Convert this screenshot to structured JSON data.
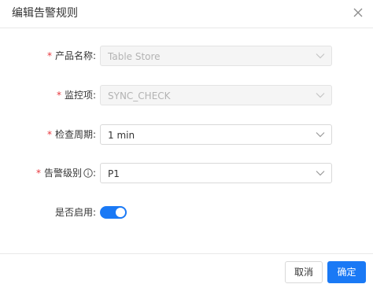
{
  "dialog": {
    "title": "编辑告警规则",
    "close_icon": "close-icon"
  },
  "form": {
    "product": {
      "required_mark": "*",
      "label": "产品名称:",
      "value": "Table Store",
      "disabled": true
    },
    "monitor_item": {
      "required_mark": "*",
      "label": "监控项:",
      "value": "SYNC_CHECK",
      "disabled": true
    },
    "check_period": {
      "required_mark": "*",
      "label": "检查周期:",
      "value": "1 min"
    },
    "alert_level": {
      "required_mark": "*",
      "label": "告警级别",
      "label_suffix": ":",
      "info_icon": "info-circle-icon",
      "value": "P1"
    },
    "enabled": {
      "label": "是否启用:",
      "value": true
    }
  },
  "footer": {
    "cancel_label": "取消",
    "confirm_label": "确定"
  },
  "colors": {
    "primary": "#1a79f5",
    "required": "#e8373d",
    "border": "#d9d9d9",
    "disabled_bg": "#f5f5f5",
    "disabled_text": "#b3b3b3"
  }
}
